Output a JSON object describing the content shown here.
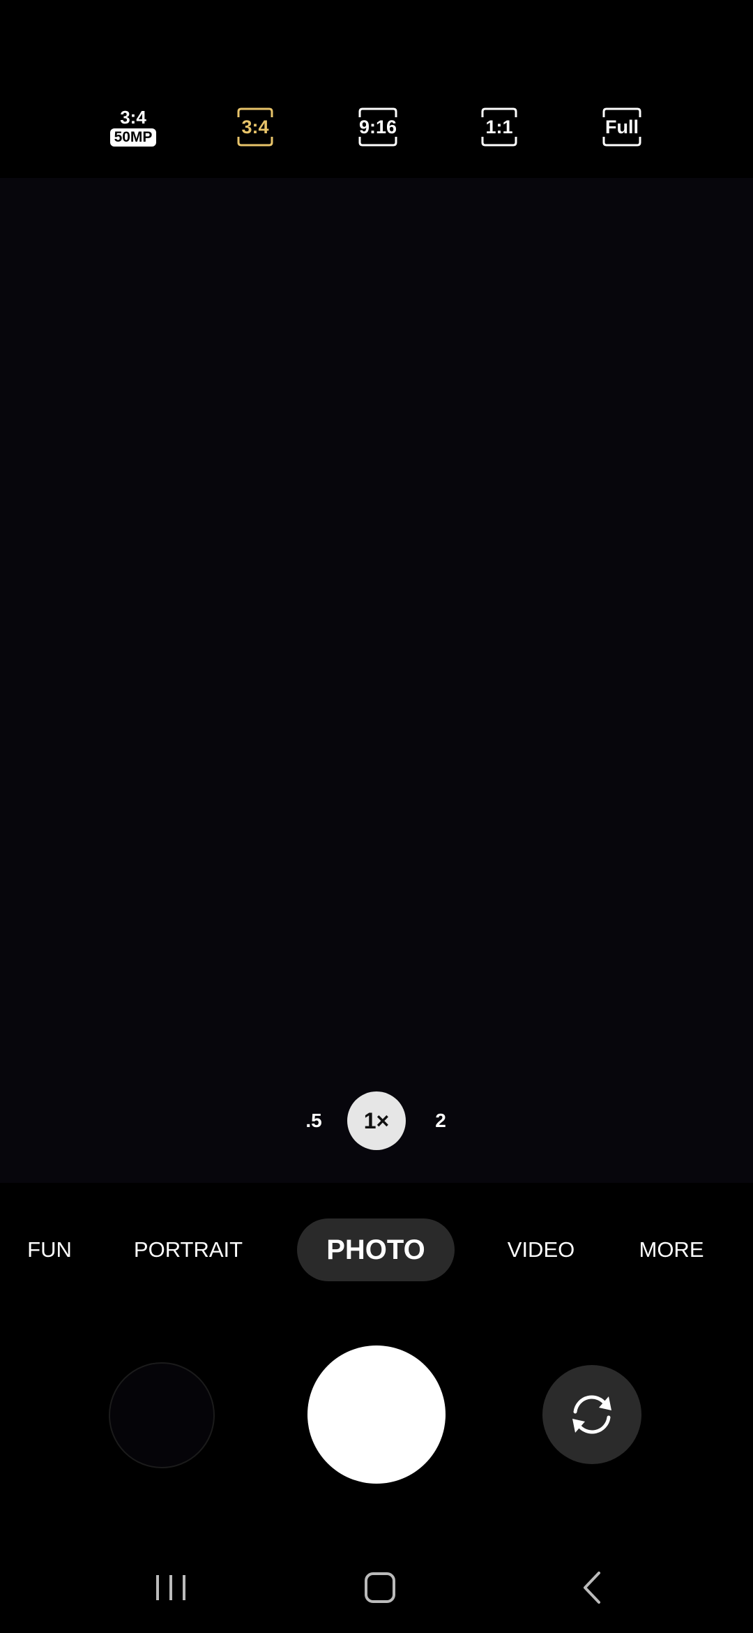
{
  "aspect_ratios": {
    "ratio_50mp_top": "3:4",
    "ratio_50mp_badge": "50MP",
    "ratio_3_4": "3:4",
    "ratio_9_16": "9:16",
    "ratio_1_1": "1:1",
    "ratio_full": "Full",
    "selected": "3:4",
    "selected_color": "#e8c46a"
  },
  "zoom": {
    "wide": ".5",
    "main": "1×",
    "tele": "2",
    "selected": "1×"
  },
  "modes": {
    "items": [
      "FUN",
      "PORTRAIT",
      "PHOTO",
      "VIDEO",
      "MORE"
    ],
    "selected": "PHOTO"
  },
  "controls": {
    "gallery": "gallery-thumbnail",
    "shutter": "shutter-button",
    "switch_camera_icon": "switch-camera-icon"
  },
  "nav": {
    "recent_icon": "recent-apps-icon",
    "home_icon": "home-icon",
    "back_icon": "back-icon"
  }
}
